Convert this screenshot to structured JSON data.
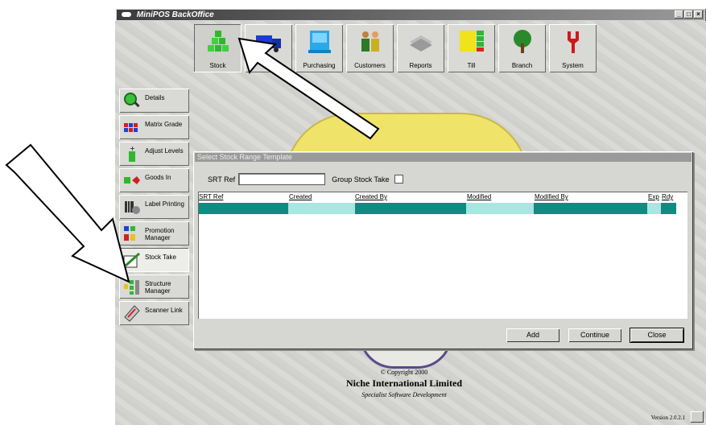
{
  "window": {
    "title": "MiniPOS BackOffice",
    "controls": [
      "minimize",
      "maximize",
      "close"
    ]
  },
  "toolbar": {
    "items": [
      {
        "label": "Stock",
        "icon": "stock-icon",
        "active": true
      },
      {
        "label": "",
        "icon": "truck-icon",
        "active": false
      },
      {
        "label": "Purchasing",
        "icon": "purchasing-icon",
        "active": false
      },
      {
        "label": "Customers",
        "icon": "customers-icon",
        "active": false
      },
      {
        "label": "Reports",
        "icon": "reports-icon",
        "active": false
      },
      {
        "label": "Till",
        "icon": "till-icon",
        "active": false
      },
      {
        "label": "Branch",
        "icon": "tree-icon",
        "active": false
      },
      {
        "label": "System",
        "icon": "wrench-icon",
        "active": false
      }
    ]
  },
  "sidebar": {
    "items": [
      {
        "label": "Details",
        "icon": "magnifier-icon"
      },
      {
        "label": "Matrix Grade",
        "icon": "matrix-icon"
      },
      {
        "label": "Adjust Levels",
        "icon": "adjust-icon"
      },
      {
        "label": "Goods In",
        "icon": "goods-in-icon"
      },
      {
        "label": "Label Printing",
        "icon": "label-printer-icon"
      },
      {
        "label": "Promotion Manager",
        "icon": "promotion-icon"
      },
      {
        "label": "Stock Take",
        "icon": "stock-take-icon",
        "active": true
      },
      {
        "label": "Structure Manager",
        "icon": "structure-icon"
      },
      {
        "label": "Scanner Link",
        "icon": "scanner-icon"
      }
    ]
  },
  "dialog": {
    "title": "Select Stock Range Template",
    "srt_ref_label": "SRT Ref",
    "srt_ref_value": "",
    "group_label": "Group Stock Take",
    "group_checked": false,
    "columns": [
      "SRT Ref",
      "Created",
      "Created By",
      "Modified",
      "Modified By",
      "Exp",
      "Rdy"
    ],
    "rows": [],
    "buttons": {
      "add": "Add",
      "continue": "Continue",
      "close": "Close"
    }
  },
  "copyright": {
    "line1": "© Copyright 2000",
    "line2": "Niche International Limited",
    "line3": "Specialist Software Development"
  },
  "version": "Version 2.0.2.1",
  "colors": {
    "teal": "#0f8c82",
    "light_teal": "#a8e6e2",
    "seal_yellow": "#f0e36a"
  }
}
